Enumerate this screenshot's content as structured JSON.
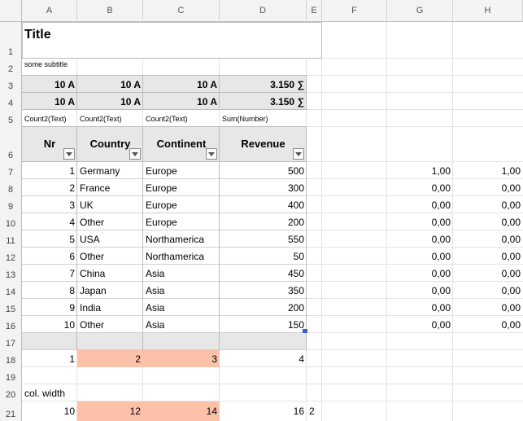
{
  "columns": [
    "A",
    "B",
    "C",
    "D",
    "E",
    "F",
    "G",
    "H"
  ],
  "rows": [
    "1",
    "2",
    "3",
    "4",
    "5",
    "6",
    "7",
    "8",
    "9",
    "10",
    "11",
    "12",
    "13",
    "14",
    "15",
    "16",
    "17",
    "18",
    "19",
    "20",
    "21"
  ],
  "title": "Title",
  "subtitle": "some subtitle",
  "summary_rows": [
    [
      "10 A",
      "10 A",
      "10 A",
      "3.150 ∑"
    ],
    [
      "10 A",
      "10 A",
      "10 A",
      "3.150 ∑"
    ]
  ],
  "summary_labels": [
    "Count2(Text)",
    "Count2(Text)",
    "Count2(Text)",
    "Sum(Number)"
  ],
  "table_headers": [
    "Nr",
    "Country",
    "Continent",
    "Revenue"
  ],
  "table_rows": [
    [
      "1",
      "Germany",
      "Europe",
      "500"
    ],
    [
      "2",
      "France",
      "Europe",
      "300"
    ],
    [
      "3",
      "UK",
      "Europe",
      "400"
    ],
    [
      "4",
      "Other",
      "Europe",
      "200"
    ],
    [
      "5",
      "USA",
      "Northamerica",
      "550"
    ],
    [
      "6",
      "Other",
      "Northamerica",
      "50"
    ],
    [
      "7",
      "China",
      "Asia",
      "450"
    ],
    [
      "8",
      "Japan",
      "Asia",
      "350"
    ],
    [
      "9",
      "India",
      "Asia",
      "200"
    ],
    [
      "10",
      "Other",
      "Asia",
      "150"
    ]
  ],
  "side_values": [
    [
      "1,00",
      "1,00"
    ],
    [
      "0,00",
      "0,00"
    ],
    [
      "0,00",
      "0,00"
    ],
    [
      "0,00",
      "0,00"
    ],
    [
      "0,00",
      "0,00"
    ],
    [
      "0,00",
      "0,00"
    ],
    [
      "0,00",
      "0,00"
    ],
    [
      "0,00",
      "0,00"
    ],
    [
      "0,00",
      "0,00"
    ],
    [
      "0,00",
      "0,00"
    ]
  ],
  "row18": [
    "1",
    "2",
    "3",
    "4"
  ],
  "col_width_label": "col. width",
  "row21": [
    "10",
    "12",
    "14",
    "16",
    "2"
  ],
  "colors": {
    "header_grey": "#e7e7e7",
    "highlight": "#fbc2a9",
    "selection_handle": "#3a5fcd"
  }
}
